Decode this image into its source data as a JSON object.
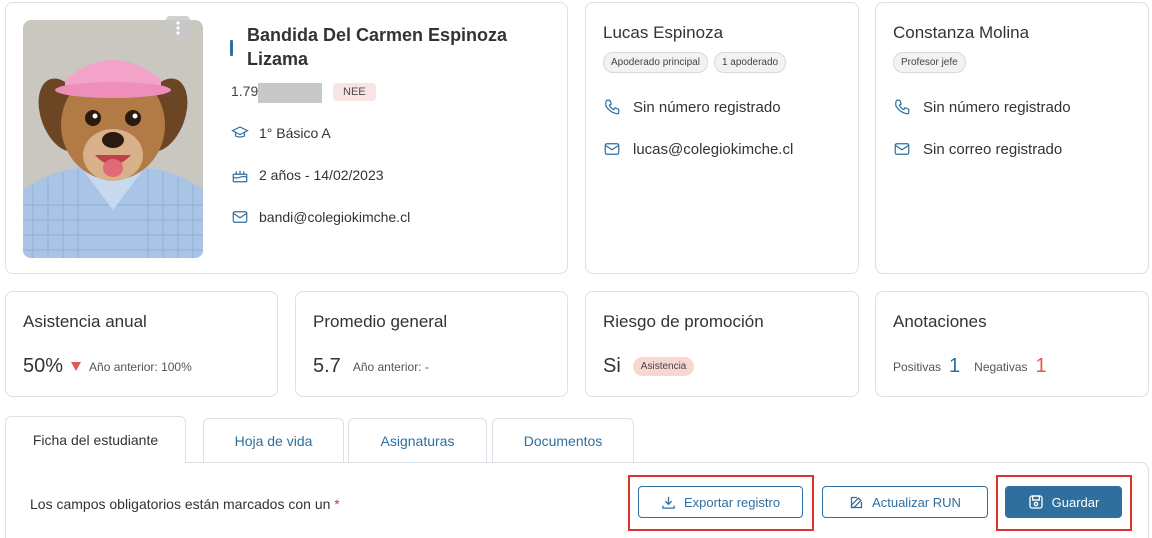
{
  "student": {
    "name": "Bandida Del Carmen Espinoza Lizama",
    "rut_visible": "1.79",
    "badge": "NEE",
    "course": "1° Básico A",
    "age_birth": "2 años - 14/02/2023",
    "email": "bandi@colegiokimche.cl"
  },
  "guardian": {
    "name": "Lucas Espinoza",
    "tags": [
      "Apoderado principal",
      "1 apoderado"
    ],
    "phone": "Sin número registrado",
    "email": "lucas@colegiokimche.cl"
  },
  "teacher": {
    "name": "Constanza Molina",
    "tags": [
      "Profesor jefe"
    ],
    "phone": "Sin número registrado",
    "email": "Sin correo registrado"
  },
  "stats": {
    "attendance": {
      "title": "Asistencia anual",
      "value": "50%",
      "previous": "Año anterior: 100%"
    },
    "average": {
      "title": "Promedio general",
      "value": "5.7",
      "previous": "Año anterior: -"
    },
    "risk": {
      "title": "Riesgo de promoción",
      "value": "Si",
      "badge": "Asistencia"
    },
    "notes": {
      "title": "Anotaciones",
      "positive_label": "Positivas",
      "positive_count": "1",
      "negative_label": "Negativas",
      "negative_count": "1"
    }
  },
  "tabs": [
    "Ficha del estudiante",
    "Hoja de vida",
    "Asignaturas",
    "Documentos"
  ],
  "active_tab": "Ficha del estudiante",
  "form": {
    "required_note": "Los campos obligatorios están marcados con un",
    "asterisk": "*"
  },
  "actions": {
    "export": "Exportar registro",
    "update_run": "Actualizar RUN",
    "save": "Guardar"
  },
  "colors": {
    "accent": "#2f6f9e",
    "danger": "#e05a4f",
    "positive": "#2f6f9e",
    "highlight": "#e0322c"
  }
}
